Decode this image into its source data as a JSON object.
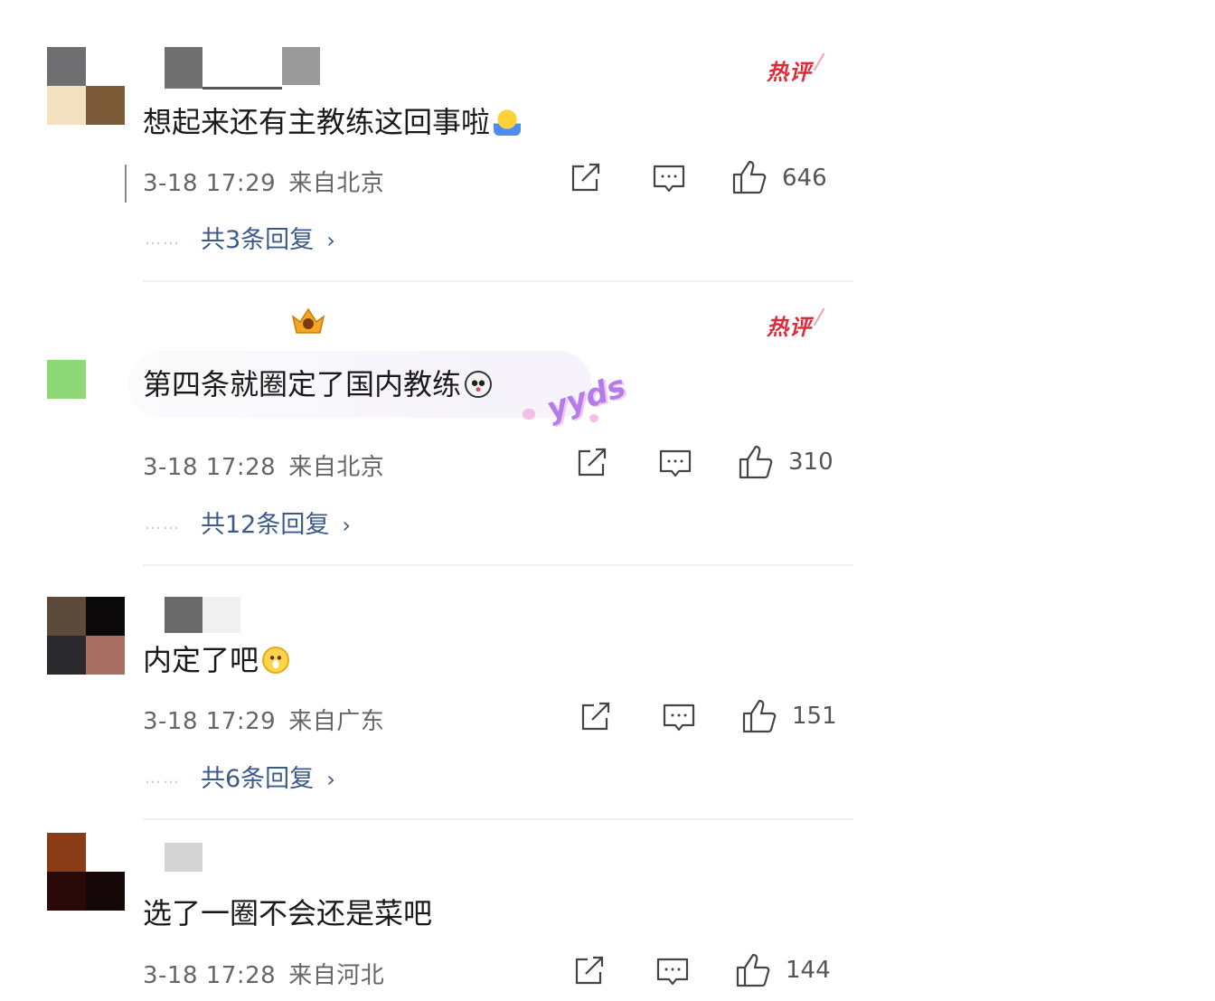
{
  "hot_label": "热评",
  "colors": {
    "hot": "#e0293a",
    "reply_link": "#3c5a8a",
    "meta_text": "#666666",
    "comment_text": "#1a1a1a"
  },
  "comments": [
    {
      "text": "想起来还有主教练这回事啦",
      "emoji": "hug-emoji",
      "date": "3-18 17:29",
      "location": "来自北京",
      "likes": "646",
      "replies": "共3条回复",
      "hot": true
    },
    {
      "text": "第四条就圈定了国内教练",
      "emoji": "panda-emoji",
      "date": "3-18 17:28",
      "location": "来自北京",
      "likes": "310",
      "replies": "共12条回复",
      "hot": true,
      "bubble_tag": "yyds"
    },
    {
      "text": "内定了吧",
      "emoji": "grin-emoji",
      "date": "3-18 17:29",
      "location": "来自广东",
      "likes": "151",
      "replies": "共6条回复",
      "hot": false
    },
    {
      "text": "选了一圈不会还是菜吧",
      "emoji": "",
      "date": "3-18 17:28",
      "location": "来自河北",
      "likes": "144",
      "replies": "",
      "hot": false
    }
  ],
  "icons": [
    "share-icon",
    "comment-icon",
    "like-icon",
    "chevron-right-icon",
    "vip-badge-icon"
  ]
}
